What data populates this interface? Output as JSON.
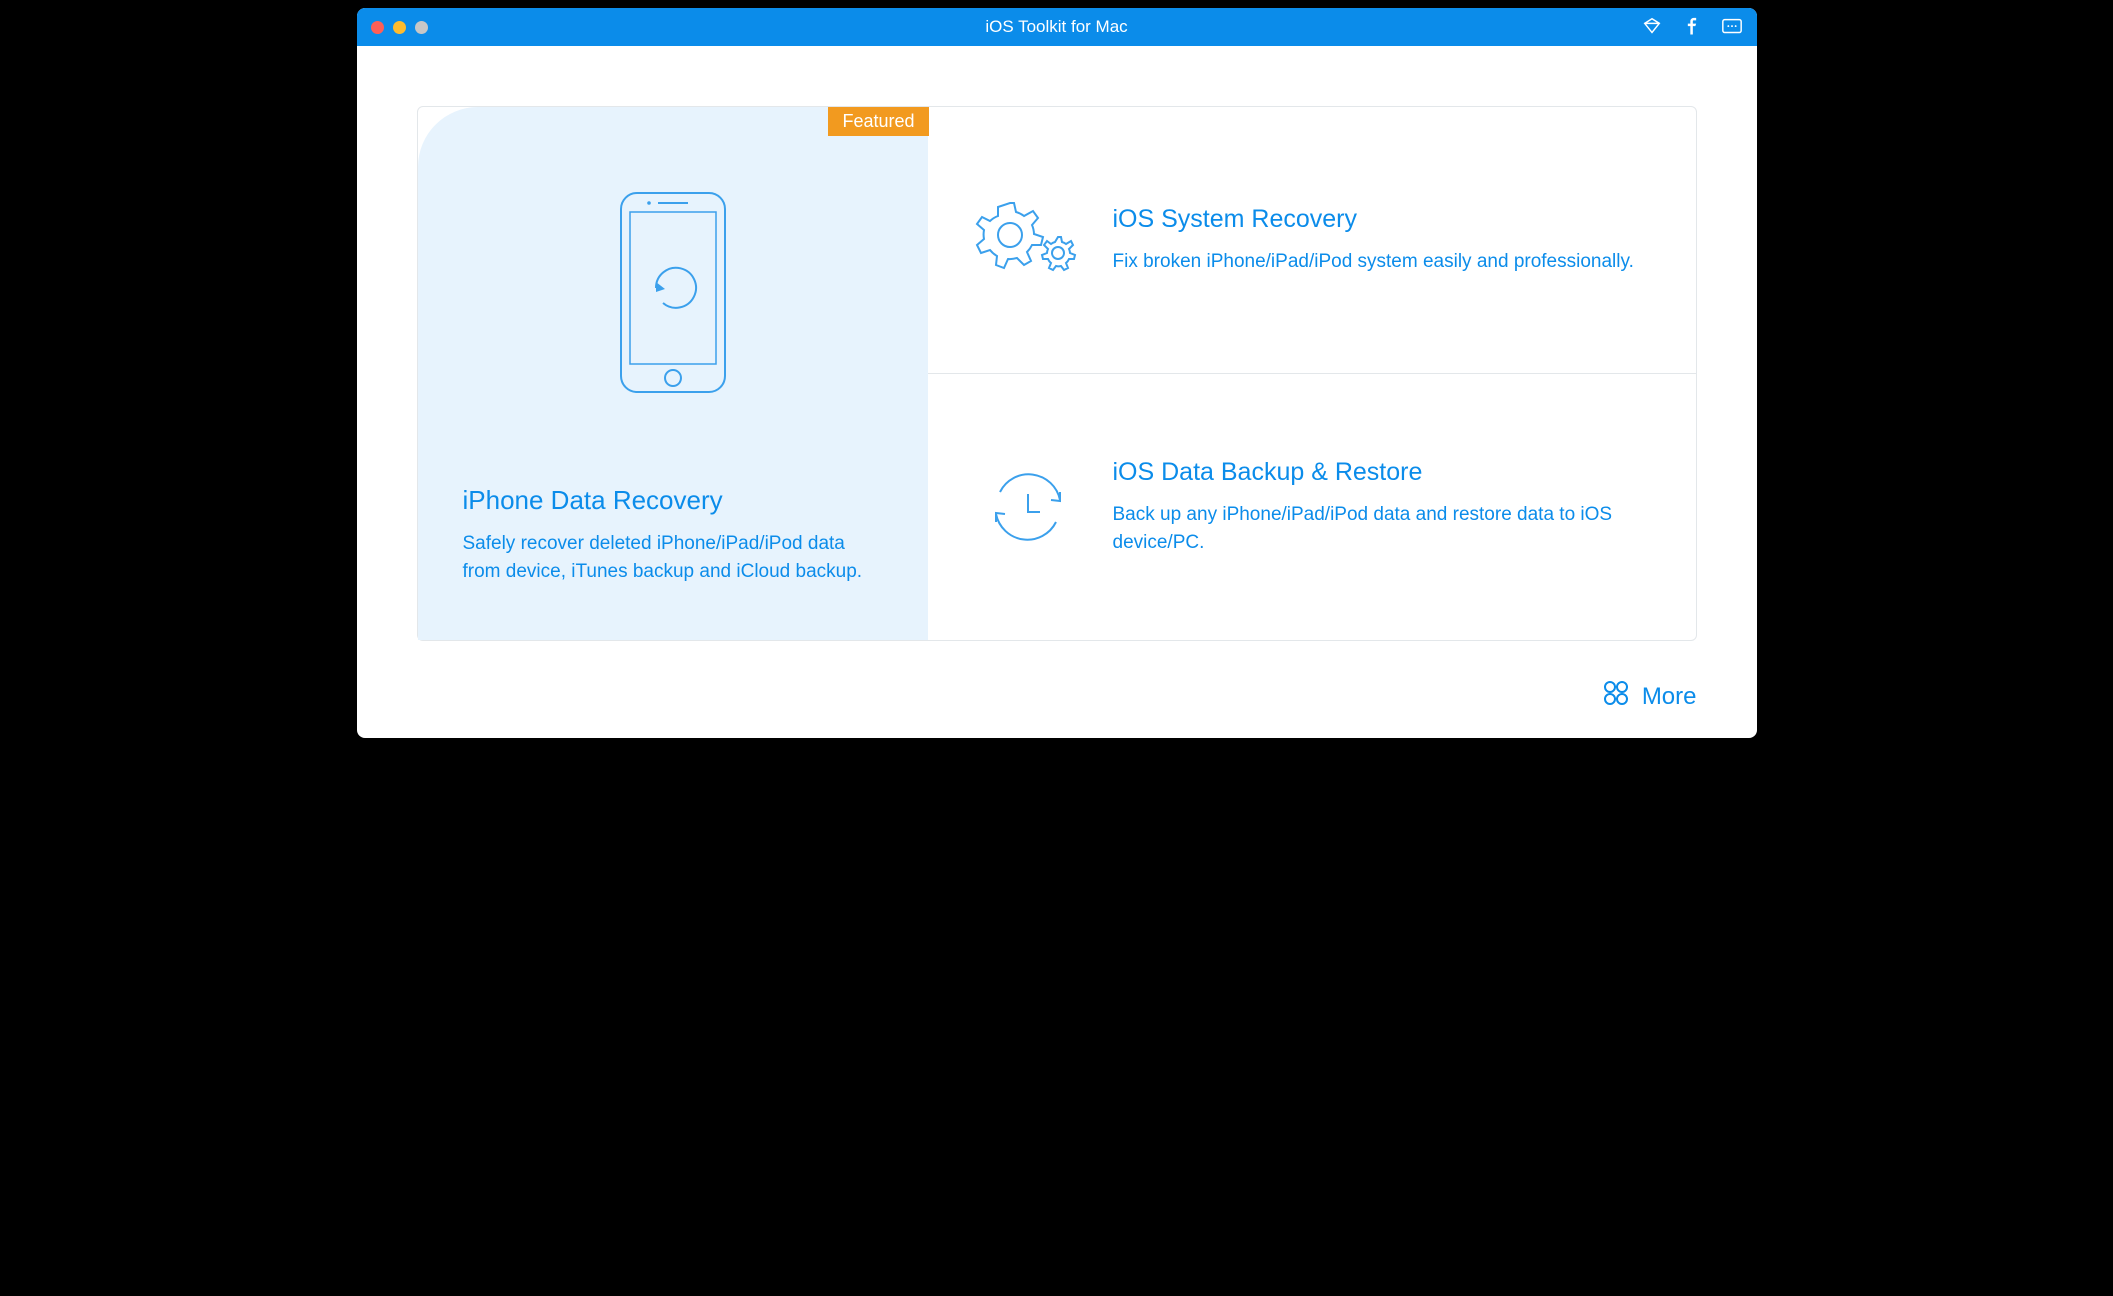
{
  "window": {
    "title": "iOS Toolkit for Mac"
  },
  "featured_label": "Featured",
  "cards": {
    "main": {
      "title": "iPhone Data Recovery",
      "desc": "Safely recover deleted iPhone/iPad/iPod data from device, iTunes backup and iCloud backup."
    },
    "system_recovery": {
      "title": "iOS System Recovery",
      "desc": "Fix broken iPhone/iPad/iPod system easily and professionally."
    },
    "backup_restore": {
      "title": "iOS Data Backup & Restore",
      "desc": "Back up any iPhone/iPad/iPod data and restore data to iOS device/PC."
    }
  },
  "footer": {
    "more_label": "More"
  }
}
